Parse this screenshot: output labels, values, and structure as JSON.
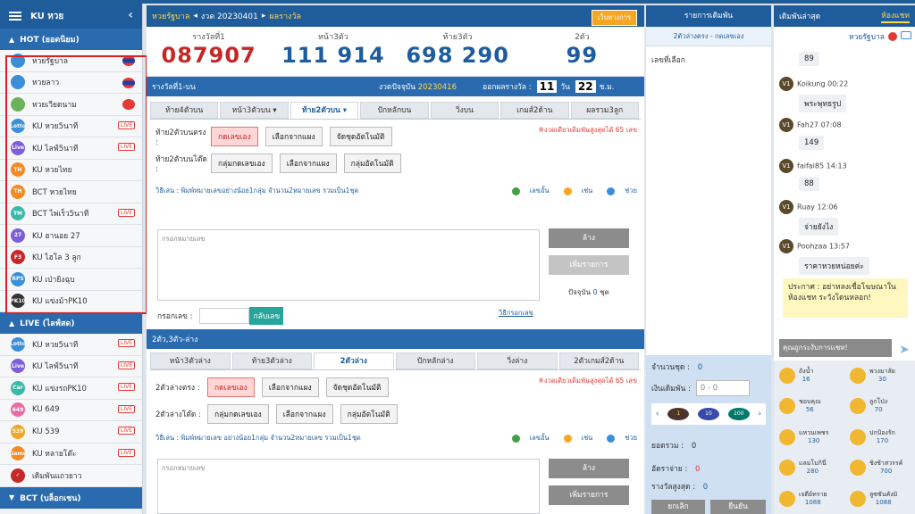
{
  "sidebar": {
    "title": "KU หวย",
    "sections": [
      {
        "label": "HOT (ยอดนิยม)"
      },
      {
        "label": "LIVE (ไลฟ์สด)"
      },
      {
        "label": "BCT (บล็อกเชน)"
      }
    ],
    "hot_items": [
      {
        "label": "หวยรัฐบาล",
        "icon": "thai-lottery-icon",
        "color": "#3a8fd8",
        "badge": "flag"
      },
      {
        "label": "หวยลาว",
        "icon": "laos-lottery-icon",
        "color": "#3a8fd8",
        "badge": "flag"
      },
      {
        "label": "หวยเวียดนาม",
        "icon": "vietnam-lottery-icon",
        "color": "#6bb35a",
        "badge": "flag"
      },
      {
        "label": "KU หวย5นาที",
        "icon": "lotto-icon",
        "color": "#3a8fd8",
        "badge": "live",
        "ic": "Lotto"
      },
      {
        "label": "KU ไลฟ์5นาที",
        "icon": "live-icon",
        "color": "#7b5ed8",
        "badge": "live",
        "ic": "Live"
      },
      {
        "label": "KU หวยไทย",
        "icon": "th-icon",
        "color": "#f28b24",
        "badge": "",
        "ic": "TH"
      },
      {
        "label": "BCT หวยไทย",
        "icon": "th-icon",
        "color": "#f28b24",
        "badge": "",
        "ic": "TH"
      },
      {
        "label": "BCT ไพ่เร็ว5นาที",
        "icon": "tm-icon",
        "color": "#3ab9a9",
        "badge": "live",
        "ic": "TM"
      },
      {
        "label": "KU ฮานอย 27",
        "icon": "27-icon",
        "color": "#7b5ed8",
        "badge": "",
        "ic": "27"
      },
      {
        "label": "KU ไฮโล 3 ลูก",
        "icon": "f3-icon",
        "color": "#c62828",
        "badge": "",
        "ic": "F3"
      },
      {
        "label": "KU เป่ายิงฉุบ",
        "icon": "rps-icon",
        "color": "#3a8fd8",
        "badge": "",
        "ic": "RPS"
      },
      {
        "label": "KU แข่งม้าPK10",
        "icon": "pk10-icon",
        "color": "#333333",
        "badge": "",
        "ic": "PK10"
      }
    ],
    "live_items": [
      {
        "label": "KU หวย5นาที",
        "icon": "lotto-icon",
        "color": "#3a8fd8",
        "badge": "live",
        "ic": "Lotto"
      },
      {
        "label": "KU ไลฟ์5นาที",
        "icon": "live-icon",
        "color": "#7b5ed8",
        "badge": "live",
        "ic": "Live"
      },
      {
        "label": "KU แข่งรถPK10",
        "icon": "car-icon",
        "color": "#3ab9a9",
        "badge": "live",
        "ic": "Car"
      },
      {
        "label": "KU 649",
        "icon": "649-icon",
        "color": "#e86ba3",
        "badge": "live",
        "ic": "649"
      },
      {
        "label": "KU 539",
        "icon": "539-icon",
        "color": "#f2a724",
        "badge": "live",
        "ic": "539"
      },
      {
        "label": "KU หลายโต๊ะ",
        "icon": "game-icon",
        "color": "#f28b24",
        "badge": "live",
        "ic": "Game"
      },
      {
        "label": "เดิมพันแถวยาว",
        "icon": "check-icon",
        "color": "#c62828",
        "badge": "",
        "ic": "✓"
      }
    ],
    "live_label": "LIVE"
  },
  "header": {
    "crumb1": "หวยรัฐบาล",
    "crumb2": "งวด 20230401",
    "crumb3": "ผลรางวัล",
    "rules_button": "เว็บทางการ"
  },
  "prizes": [
    {
      "label": "รางวัลที่1",
      "value": "087907"
    },
    {
      "label": "หน้า3ตัว",
      "value": "111 914"
    },
    {
      "label": "ท้าย3ตัว",
      "value": "698 290"
    },
    {
      "label": "2ตัว",
      "value": "99"
    }
  ],
  "round_bar": {
    "left": "รางวัลที่1-บน",
    "current_label": "งวดปัจจุบัน",
    "current_value": "20230416",
    "close_label": "ออกผลรางวัล :",
    "day": "11",
    "day_unit": "วัน",
    "hour": "22",
    "hour_unit": "ช.ม."
  },
  "upper": {
    "tabs": [
      "ท้าย4ตัวบน",
      "หน้า3ตัวบน ▾",
      "ท้าย2ตัวบน ▾",
      "ปักหลักบน",
      "วิ่งบน",
      "เกมส์2ด้าน",
      "ผลรวม3ลูก"
    ],
    "row1_label": "ท้าย2ตัวบนตรง :",
    "row1_buttons": [
      "กดเลขเอง",
      "เลือกจากแผง",
      "จัดชุดอัตโนมัติ"
    ],
    "row2_label": "ท้าย2ตัวบนโต๊ด :",
    "row2_buttons": [
      "กลุ่มกดเลขเอง",
      "เลือกจากแผง",
      "กลุ่มอัตโนมัติ"
    ],
    "note": "※งวดเดียวเดิมพันสูงสุดได้ 65 เลข",
    "howto": "วิธีเล่น : พิมพ์หมายเลขอย่างน้อย1กลุ่ม จำนวน2หมายเลข รวมเป็น1ชุด",
    "links": [
      "เลขอั้น",
      "เช่น",
      "ช่วย"
    ],
    "textarea_placeholder": "กรอกหมายเลข",
    "clear_button": "ล้าง",
    "add_button": "เพิ่มรายการ",
    "current_label": "ปัจจุบัน",
    "current_value": "0",
    "current_unit": "ชุด",
    "input_label": "กรอกเลข :",
    "reverse_button": "กลับเลข",
    "how_input_link": "วิธีกรอกเลข"
  },
  "lower": {
    "bar_title": "2ตัว,3ตัว-ล่าง",
    "tabs": [
      "หน้า3ตัวล่าง",
      "ท้าย3ตัวล่าง",
      "2ตัวล่าง",
      "ปักหลักล่าง",
      "วิ่งล่าง",
      "2ตัวเกมส์2ด้าน"
    ],
    "row1_label": "2ตัวล่างตรง :",
    "row1_buttons": [
      "กดเลขเอง",
      "เลือกจากแผง",
      "จัดชุดอัตโนมัติ"
    ],
    "row2_label": "2ตัวล่างโต๊ด :",
    "row2_buttons": [
      "กลุ่มกดเลขเอง",
      "เลือกจากแผง",
      "กลุ่มอัตโนมัติ"
    ],
    "note": "※งวดเดียวเดิมพันสูงสุดได้ 65 เลข",
    "howto": "วิธีเล่น : พิมพ์หมายเลข อย่างน้อย1กลุ่ม จำนวน2หมายเลข รวมเป็น1ชุด",
    "links": [
      "เลขอั้น",
      "เช่น",
      "ช่วย"
    ],
    "textarea_placeholder": "กรอกหมายเลข",
    "clear_button": "ล้าง",
    "add_button": "เพิ่มรายการ"
  },
  "betpanel": {
    "title": "รายการเดิมพัน",
    "subtitle": "2ตัวล่างตรง - กดเลขเอง",
    "selected_label": "เลขที่เลือก",
    "count_label": "จำนวนชุด :",
    "count_value": "0",
    "amount_label": "เงินเดิมพัน :",
    "amount_value": "0 - 0",
    "chips": [
      "1",
      "10",
      "100"
    ],
    "total_label": "ยอดรวม :",
    "total_value": "0",
    "rate_label": "อัตราจ่าย :",
    "rate_value": "0",
    "max_label": "รางวัลสูงสุด :",
    "max_value": "0",
    "cancel_button": "ยกเลิก",
    "confirm_button": "ยืนยัน"
  },
  "chat": {
    "tab_latest": "เดิมพันล่าสุด",
    "tab_chat": "ห้องแชท",
    "room": "หวยรัฐบาล",
    "messages": [
      {
        "user": "",
        "time": "",
        "text": "89"
      },
      {
        "user": "Koikung",
        "time": "00:22",
        "text": "พระพุทธรูป"
      },
      {
        "user": "Fah27",
        "time": "07:08",
        "text": "149"
      },
      {
        "user": "faifai85",
        "time": "14:13",
        "text": "88"
      },
      {
        "user": "Ruay",
        "time": "12:06",
        "text": "จ่ายยังไง"
      },
      {
        "user": "Poohzaa",
        "time": "13:57",
        "text": "ราคาหวยหน่อยค่ะ"
      }
    ],
    "announcement": "ประกาศ : อย่าหลงเชื่อโฆษณาในห้องแชท ระวังโดนหลอก!",
    "input_placeholder": "คุณถูกระงับการแชท!",
    "gifts": [
      {
        "name": "ถังน้ำ",
        "value": "16"
      },
      {
        "name": "พวงมาลัย",
        "value": "30"
      },
      {
        "name": "ชอบคุณ",
        "value": "56"
      },
      {
        "name": "ลูกโป่ง",
        "value": "70"
      },
      {
        "name": "แหวนเพชร",
        "value": "130"
      },
      {
        "name": "ปกป้องรัก",
        "value": "170"
      },
      {
        "name": "แลมโบกินี่",
        "value": "280"
      },
      {
        "name": "ชิงช้าสวรรค์",
        "value": "700"
      },
      {
        "name": "เจดีย์ทราย",
        "value": "1088"
      },
      {
        "name": "ลูซซันคังมิ",
        "value": "1088"
      }
    ],
    "avatar_initials": "V1"
  }
}
